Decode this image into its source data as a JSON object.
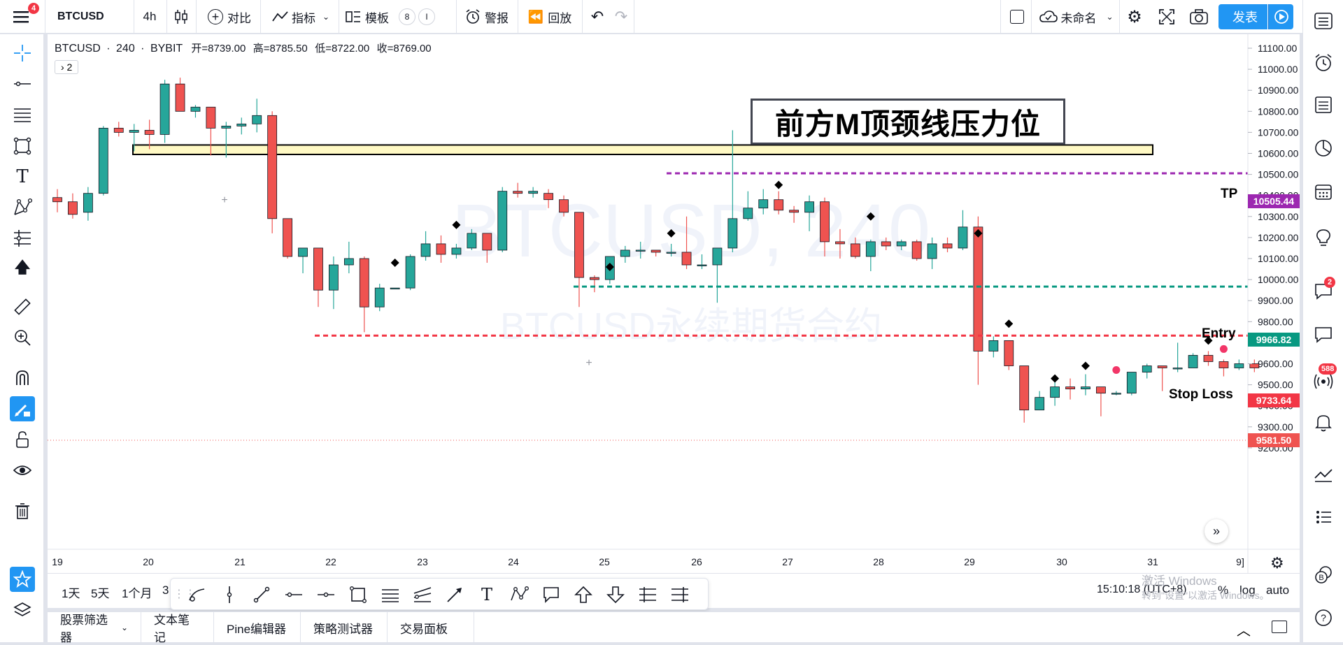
{
  "topbar": {
    "menu_badge": "4",
    "symbol": "BTCUSD",
    "interval": "4h",
    "compare": "对比",
    "indicators": "指标",
    "templates": "模板",
    "template_badge_1": "8",
    "template_badge_2": "I",
    "alert": "警报",
    "replay": "回放",
    "layout_name": "未命名",
    "publish": "发表"
  },
  "legend": {
    "symbol": "BTCUSD",
    "interval": "240",
    "exchange": "BYBIT",
    "open": "开=8739.00",
    "high": "高=8785.50",
    "low": "低=8722.00",
    "close": "收=8769.00",
    "collapsed_count": "› 2"
  },
  "watermark": {
    "main": "BTCUSD, 240",
    "sub": "BTCUSD永续期货合约"
  },
  "annotation": {
    "title": "前方M顶颈线压力位"
  },
  "levels": {
    "tp_label": "TP",
    "tp_value": "10505.44",
    "tp_color": "#9c27b0",
    "entry_label": "Entry",
    "entry_value": "9966.82",
    "entry_color": "#089981",
    "sl_label": "Stop Loss",
    "sl_value": "9733.64",
    "sl_color": "#f23645",
    "last_price": "9581.50",
    "last_color": "#ef5350"
  },
  "price_axis": [
    "11100.00",
    "11000.00",
    "10900.00",
    "10800.00",
    "10700.00",
    "10600.00",
    "10500.00",
    "10400.00",
    "10300.00",
    "10200.00",
    "10100.00",
    "10000.00",
    "9900.00",
    "9800.00",
    "9700.00",
    "9600.00",
    "9500.00",
    "9400.00",
    "9300.00",
    "9200.00"
  ],
  "time_axis": [
    "19",
    "20",
    "21",
    "22",
    "23",
    "24",
    "25",
    "26",
    "27",
    "28",
    "29",
    "30",
    "31",
    "9]"
  ],
  "bottombar": {
    "ranges": [
      "1天",
      "5天",
      "1个月",
      "3"
    ],
    "clock": "15:10:18 (UTC+8)",
    "pct": "%",
    "log": "log",
    "auto": "auto"
  },
  "footer": {
    "tabs": [
      "股票筛选器",
      "文本笔记",
      "Pine编辑器",
      "策略测试器",
      "交易面板"
    ]
  },
  "os_watermark": {
    "line1": "激活 Windows",
    "line2": "转到\"设置\"以激活 Windows。"
  },
  "right_badges": {
    "chat": "2",
    "ideas": "588"
  },
  "chart_data": {
    "type": "candlestick",
    "symbol": "BTCUSD",
    "interval": "240",
    "ylim": [
      9150,
      11180
    ],
    "x_ticks": [
      "19",
      "20",
      "21",
      "22",
      "23",
      "24",
      "25",
      "26",
      "27",
      "28",
      "29",
      "30",
      "31"
    ],
    "candles": [
      {
        "o": 10390,
        "h": 10430,
        "l": 10320,
        "c": 10370
      },
      {
        "o": 10370,
        "h": 10410,
        "l": 10290,
        "c": 10310
      },
      {
        "o": 10320,
        "h": 10440,
        "l": 10280,
        "c": 10410
      },
      {
        "o": 10410,
        "h": 10730,
        "l": 10400,
        "c": 10720
      },
      {
        "o": 10720,
        "h": 10750,
        "l": 10680,
        "c": 10700
      },
      {
        "o": 10700,
        "h": 10740,
        "l": 10610,
        "c": 10710
      },
      {
        "o": 10710,
        "h": 10760,
        "l": 10620,
        "c": 10690
      },
      {
        "o": 10690,
        "h": 10950,
        "l": 10650,
        "c": 10930
      },
      {
        "o": 10930,
        "h": 10960,
        "l": 10800,
        "c": 10800
      },
      {
        "o": 10800,
        "h": 10830,
        "l": 10770,
        "c": 10820
      },
      {
        "o": 10820,
        "h": 10820,
        "l": 10590,
        "c": 10720
      },
      {
        "o": 10720,
        "h": 10750,
        "l": 10580,
        "c": 10730
      },
      {
        "o": 10730,
        "h": 10770,
        "l": 10690,
        "c": 10740
      },
      {
        "o": 10740,
        "h": 10860,
        "l": 10700,
        "c": 10780
      },
      {
        "o": 10780,
        "h": 10800,
        "l": 10220,
        "c": 10290
      },
      {
        "o": 10290,
        "h": 10290,
        "l": 10100,
        "c": 10110
      },
      {
        "o": 10110,
        "h": 10150,
        "l": 10030,
        "c": 10150
      },
      {
        "o": 10150,
        "h": 10150,
        "l": 9870,
        "c": 9950
      },
      {
        "o": 9950,
        "h": 10110,
        "l": 9860,
        "c": 10070
      },
      {
        "o": 10070,
        "h": 10180,
        "l": 10030,
        "c": 10100
      },
      {
        "o": 10100,
        "h": 10110,
        "l": 9750,
        "c": 9870
      },
      {
        "o": 9870,
        "h": 9980,
        "l": 9850,
        "c": 9960
      },
      {
        "o": 9960,
        "h": 9960,
        "l": 9960,
        "c": 9960
      },
      {
        "o": 9960,
        "h": 10120,
        "l": 9950,
        "c": 10110
      },
      {
        "o": 10110,
        "h": 10230,
        "l": 10090,
        "c": 10170
      },
      {
        "o": 10170,
        "h": 10210,
        "l": 10080,
        "c": 10120
      },
      {
        "o": 10120,
        "h": 10170,
        "l": 10100,
        "c": 10150
      },
      {
        "o": 10150,
        "h": 10240,
        "l": 10140,
        "c": 10220
      },
      {
        "o": 10220,
        "h": 10220,
        "l": 10080,
        "c": 10140
      },
      {
        "o": 10140,
        "h": 10440,
        "l": 10130,
        "c": 10420
      },
      {
        "o": 10420,
        "h": 10460,
        "l": 10390,
        "c": 10410
      },
      {
        "o": 10410,
        "h": 10440,
        "l": 10390,
        "c": 10420
      },
      {
        "o": 10410,
        "h": 10430,
        "l": 10340,
        "c": 10380
      },
      {
        "o": 10380,
        "h": 10400,
        "l": 10300,
        "c": 10320
      },
      {
        "o": 10320,
        "h": 10320,
        "l": 9870,
        "c": 10010
      },
      {
        "o": 10010,
        "h": 10020,
        "l": 9940,
        "c": 10000
      },
      {
        "o": 10000,
        "h": 10100,
        "l": 9980,
        "c": 10110
      },
      {
        "o": 10110,
        "h": 10160,
        "l": 10080,
        "c": 10140
      },
      {
        "o": 10140,
        "h": 10180,
        "l": 10100,
        "c": 10140
      },
      {
        "o": 10140,
        "h": 10140,
        "l": 10110,
        "c": 10130
      },
      {
        "o": 10130,
        "h": 10170,
        "l": 10110,
        "c": 10130
      },
      {
        "o": 10130,
        "h": 10300,
        "l": 10050,
        "c": 10070
      },
      {
        "o": 10070,
        "h": 10120,
        "l": 10050,
        "c": 10070
      },
      {
        "o": 10070,
        "h": 10150,
        "l": 9890,
        "c": 10150
      },
      {
        "o": 10150,
        "h": 10710,
        "l": 10130,
        "c": 10290
      },
      {
        "o": 10290,
        "h": 10420,
        "l": 10280,
        "c": 10340
      },
      {
        "o": 10340,
        "h": 10430,
        "l": 10310,
        "c": 10380
      },
      {
        "o": 10380,
        "h": 10420,
        "l": 10310,
        "c": 10330
      },
      {
        "o": 10330,
        "h": 10350,
        "l": 10270,
        "c": 10320
      },
      {
        "o": 10320,
        "h": 10400,
        "l": 10230,
        "c": 10370
      },
      {
        "o": 10370,
        "h": 10390,
        "l": 10110,
        "c": 10180
      },
      {
        "o": 10180,
        "h": 10240,
        "l": 10100,
        "c": 10170
      },
      {
        "o": 10170,
        "h": 10200,
        "l": 10100,
        "c": 10110
      },
      {
        "o": 10110,
        "h": 10190,
        "l": 10040,
        "c": 10180
      },
      {
        "o": 10180,
        "h": 10200,
        "l": 10140,
        "c": 10160
      },
      {
        "o": 10160,
        "h": 10190,
        "l": 10140,
        "c": 10180
      },
      {
        "o": 10180,
        "h": 10190,
        "l": 10090,
        "c": 10100
      },
      {
        "o": 10100,
        "h": 10200,
        "l": 10050,
        "c": 10170
      },
      {
        "o": 10170,
        "h": 10200,
        "l": 10130,
        "c": 10150
      },
      {
        "o": 10150,
        "h": 10330,
        "l": 10140,
        "c": 10250
      },
      {
        "o": 10250,
        "h": 10300,
        "l": 9500,
        "c": 9660
      },
      {
        "o": 9660,
        "h": 9730,
        "l": 9630,
        "c": 9710
      },
      {
        "o": 9710,
        "h": 9710,
        "l": 9570,
        "c": 9590
      },
      {
        "o": 9590,
        "h": 9590,
        "l": 9320,
        "c": 9380
      },
      {
        "o": 9380,
        "h": 9470,
        "l": 9380,
        "c": 9440
      },
      {
        "o": 9440,
        "h": 9530,
        "l": 9400,
        "c": 9490
      },
      {
        "o": 9490,
        "h": 9530,
        "l": 9430,
        "c": 9480
      },
      {
        "o": 9480,
        "h": 9550,
        "l": 9450,
        "c": 9490
      },
      {
        "o": 9490,
        "h": 9490,
        "l": 9350,
        "c": 9460
      },
      {
        "o": 9460,
        "h": 9470,
        "l": 9450,
        "c": 9460
      },
      {
        "o": 9460,
        "h": 9560,
        "l": 9450,
        "c": 9560
      },
      {
        "o": 9560,
        "h": 9600,
        "l": 9530,
        "c": 9590
      },
      {
        "o": 9590,
        "h": 9590,
        "l": 9470,
        "c": 9580
      },
      {
        "o": 9580,
        "h": 9700,
        "l": 9560,
        "c": 9580
      },
      {
        "o": 9580,
        "h": 9650,
        "l": 9580,
        "c": 9640
      },
      {
        "o": 9640,
        "h": 9660,
        "l": 9590,
        "c": 9610
      },
      {
        "o": 9610,
        "h": 9620,
        "l": 9540,
        "c": 9580
      },
      {
        "o": 9580,
        "h": 9620,
        "l": 9570,
        "c": 9600
      },
      {
        "o": 9600,
        "h": 9620,
        "l": 9560,
        "c": 9580
      }
    ],
    "markers": [
      {
        "i": 22,
        "p": 10080,
        "kind": "diamond"
      },
      {
        "i": 26,
        "p": 10260,
        "kind": "diamond"
      },
      {
        "i": 36,
        "p": 10060,
        "kind": "diamond"
      },
      {
        "i": 40,
        "p": 10220,
        "kind": "diamond"
      },
      {
        "i": 47,
        "p": 10450,
        "kind": "diamond"
      },
      {
        "i": 53,
        "p": 10300,
        "kind": "diamond"
      },
      {
        "i": 60,
        "p": 10220,
        "kind": "diamond"
      },
      {
        "i": 62,
        "p": 9790,
        "kind": "diamond"
      },
      {
        "i": 65,
        "p": 9530,
        "kind": "diamond"
      },
      {
        "i": 67,
        "p": 9590,
        "kind": "diamond"
      },
      {
        "i": 69,
        "p": 9570,
        "kind": "dot"
      },
      {
        "i": 75,
        "p": 9710,
        "kind": "diamond"
      },
      {
        "i": 76,
        "p": 9670,
        "kind": "dot"
      }
    ],
    "levels": [
      {
        "name": "TP",
        "price": 10505.44,
        "color": "#9c27b0"
      },
      {
        "name": "Entry",
        "price": 9966.82,
        "color": "#089981"
      },
      {
        "name": "Stop Loss",
        "price": 9733.64,
        "color": "#f23645"
      }
    ],
    "resistance_zone": [
      10595,
      10640
    ]
  }
}
